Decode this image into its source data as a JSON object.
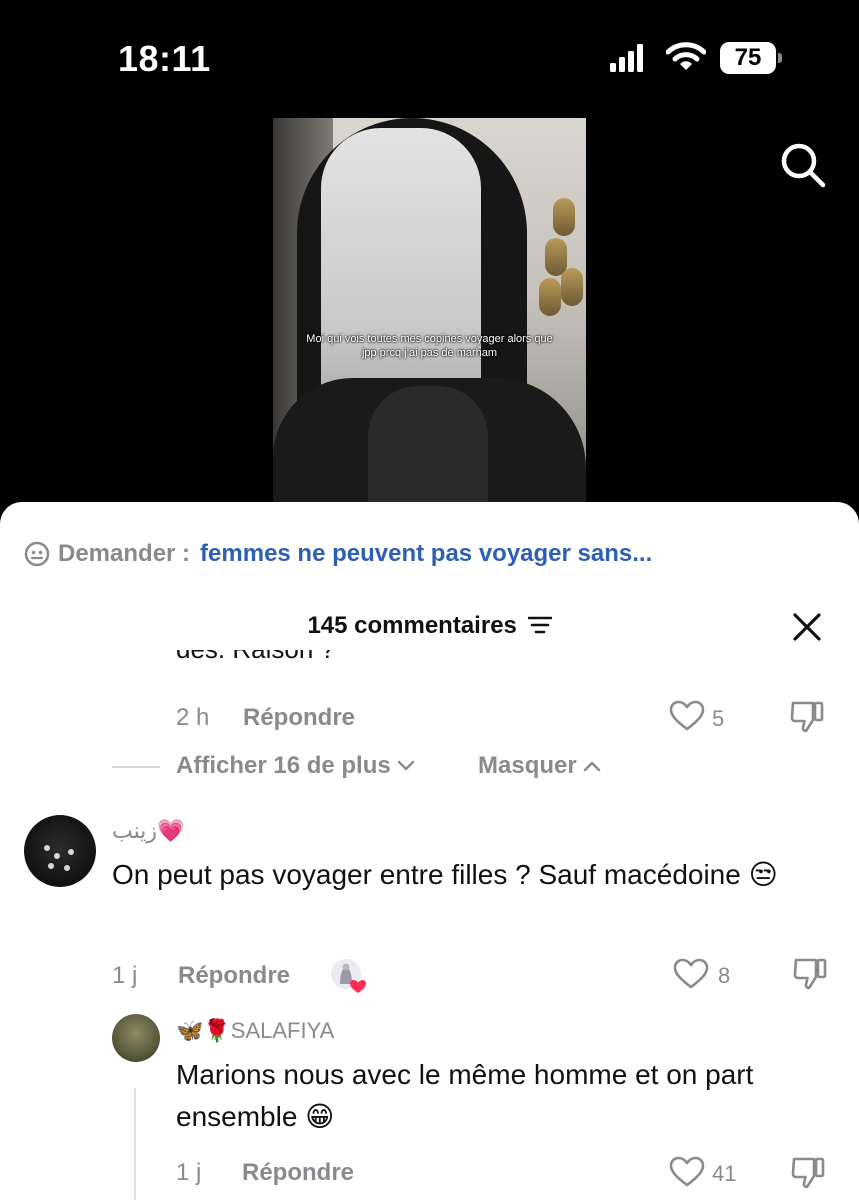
{
  "status_bar": {
    "time": "18:11",
    "battery": "75"
  },
  "video": {
    "caption": "Moi qui vois toutes mes copines voyager alors que jpp prcq j’ai pas de marham"
  },
  "search": {
    "label": "Demander :",
    "query": "femmes ne peuvent pas voyager sans..."
  },
  "comments_header": {
    "title": "145 commentaires"
  },
  "previous_comment": {
    "clipped_text": "des. Raison ?",
    "time": "2 h",
    "reply_label": "Répondre",
    "likes": "5"
  },
  "replies_controls": {
    "show_more": "Afficher 16 de plus",
    "hide": "Masquer"
  },
  "comments": [
    {
      "username": "زينب💗",
      "text": "On peut pas voyager entre filles ? Sauf macédoine 😒",
      "time": "1 j",
      "reply_label": "Répondre",
      "likes": "8"
    },
    {
      "username": "🦋🌹SALAFIYA",
      "text": "Marions nous avec le même homme et on part ensemble 😁",
      "time": "1 j",
      "reply_label": "Répondre",
      "likes": "41"
    }
  ]
}
